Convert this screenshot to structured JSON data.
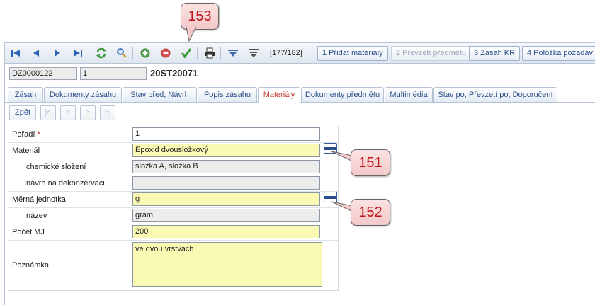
{
  "callouts": [
    "153",
    "151",
    "152"
  ],
  "toolbar": {
    "icons": [
      "first-icon",
      "prev-icon",
      "next-icon",
      "last-icon",
      "refresh-icon",
      "search-icon",
      "add-icon",
      "delete-icon",
      "confirm-icon",
      "print-icon",
      "filter-icon",
      "clear-filter-icon"
    ],
    "counter": "[177/182]",
    "buttons": [
      {
        "label": "1 Přidat materiály",
        "enabled": true
      },
      {
        "label": "2 Převzetí předmětu",
        "enabled": false
      },
      {
        "label": "3 Zásah KR",
        "enabled": true
      },
      {
        "label": "4 Položka požadav",
        "enabled": true
      }
    ]
  },
  "record": {
    "code": "DZ0000122",
    "number": "1",
    "title": "20ST20071"
  },
  "tabs": [
    "Zásah",
    "Dokumenty zásahu",
    "Stav před, Návrh",
    "Popis zásahu",
    "Materiály",
    "Dokumenty předmětu",
    "Multimédia",
    "Stav po, Převzetí po, Doporučení"
  ],
  "active_tab": "Materiály",
  "nav": {
    "back": "Zpět",
    "first": "|<",
    "prev": "<",
    "next": ">",
    "last": ">|"
  },
  "form": {
    "poradi_label": "Pořadí",
    "required_mark": "*",
    "poradi_value": "1",
    "material_label": "Materiál",
    "material_value": "Epoxid dvousložkový",
    "chem_label": "chemické složení",
    "chem_value": "složka A, složka B",
    "dekon_label": "návrh na dekonzervaci",
    "dekon_value": "",
    "mj_label": "Měrná jednotka",
    "mj_value": "g",
    "nazev_label": "název",
    "nazev_value": "gram",
    "pocet_label": "Počet MJ",
    "pocet_value": "200",
    "poznamka_label": "Poznámka",
    "poznamka_value": "ve dvou vrstvách"
  },
  "colors": {
    "accent": "#2a4f8a",
    "required_field": "#fafab4",
    "callout_text": "#c0141c"
  }
}
